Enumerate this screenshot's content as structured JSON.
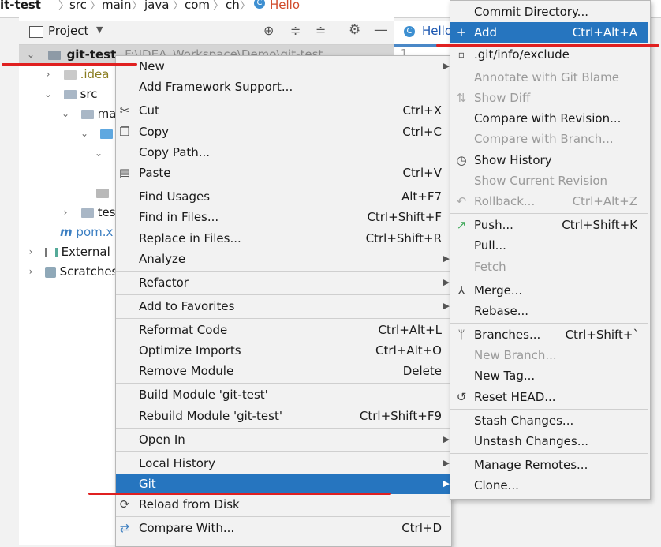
{
  "breadcrumb": {
    "items": [
      "it-test",
      "src",
      "main",
      "java",
      "com",
      "ch",
      "Hello"
    ]
  },
  "project_panel": {
    "title": "Project",
    "tree": {
      "root": "git-test",
      "root_path": "F:\\IDEA_Workspace\\Demo\\git-test",
      "idea": ".idea",
      "src": "src",
      "main": "ma",
      "test": "tes",
      "pom": "pom.x",
      "external": "External L",
      "scratches": "Scratches"
    }
  },
  "editor": {
    "tab": "Hello",
    "line_number": "1"
  },
  "context_menu": {
    "items": [
      {
        "label": "New",
        "submenu": true
      },
      {
        "label": "Add Framework Support..."
      },
      {
        "label": "Cut",
        "shortcut": "Ctrl+X",
        "icon": "scissors-icon"
      },
      {
        "label": "Copy",
        "shortcut": "Ctrl+C",
        "icon": "copy-icon"
      },
      {
        "label": "Copy Path..."
      },
      {
        "label": "Paste",
        "shortcut": "Ctrl+V",
        "icon": "paste-icon"
      },
      {
        "label": "Find Usages",
        "shortcut": "Alt+F7"
      },
      {
        "label": "Find in Files...",
        "shortcut": "Ctrl+Shift+F"
      },
      {
        "label": "Replace in Files...",
        "shortcut": "Ctrl+Shift+R"
      },
      {
        "label": "Analyze",
        "submenu": true
      },
      {
        "label": "Refactor",
        "submenu": true
      },
      {
        "label": "Add to Favorites",
        "submenu": true
      },
      {
        "label": "Reformat Code",
        "shortcut": "Ctrl+Alt+L"
      },
      {
        "label": "Optimize Imports",
        "shortcut": "Ctrl+Alt+O"
      },
      {
        "label": "Remove Module",
        "shortcut": "Delete"
      },
      {
        "label": "Build Module 'git-test'"
      },
      {
        "label": "Rebuild Module 'git-test'",
        "shortcut": "Ctrl+Shift+F9"
      },
      {
        "label": "Open In",
        "submenu": true
      },
      {
        "label": "Local History",
        "submenu": true
      },
      {
        "label": "Git",
        "submenu": true,
        "selected": true
      },
      {
        "label": "Reload from Disk",
        "icon": "reload-icon"
      },
      {
        "label": "Compare With...",
        "shortcut": "Ctrl+D",
        "icon": "compare-icon"
      }
    ]
  },
  "git_menu": {
    "items": [
      {
        "label": "Commit Directory..."
      },
      {
        "label": "Add",
        "shortcut": "Ctrl+Alt+A",
        "icon": "plus-icon",
        "selected": true
      },
      {
        "label": ".git/info/exclude",
        "icon": "file-icon"
      },
      {
        "label": "Annotate with Git Blame",
        "disabled": true
      },
      {
        "label": "Show Diff",
        "disabled": true,
        "icon": "diff-icon"
      },
      {
        "label": "Compare with Revision..."
      },
      {
        "label": "Compare with Branch...",
        "disabled": true
      },
      {
        "label": "Show History",
        "icon": "clock-icon"
      },
      {
        "label": "Show Current Revision",
        "disabled": true
      },
      {
        "label": "Rollback...",
        "shortcut": "Ctrl+Alt+Z",
        "disabled": true,
        "icon": "rollback-icon"
      },
      {
        "label": "Push...",
        "shortcut": "Ctrl+Shift+K",
        "icon": "push-icon"
      },
      {
        "label": "Pull..."
      },
      {
        "label": "Fetch",
        "disabled": true
      },
      {
        "label": "Merge...",
        "icon": "merge-icon"
      },
      {
        "label": "Rebase..."
      },
      {
        "label": "Branches...",
        "shortcut": "Ctrl+Shift+`",
        "icon": "branch-icon"
      },
      {
        "label": "New Branch...",
        "disabled": true
      },
      {
        "label": "New Tag..."
      },
      {
        "label": "Reset HEAD...",
        "icon": "reset-icon"
      },
      {
        "label": "Stash Changes..."
      },
      {
        "label": "Unstash Changes..."
      },
      {
        "label": "Manage Remotes..."
      },
      {
        "label": "Clone..."
      }
    ]
  },
  "colors": {
    "highlight": "#2675bf",
    "annotation_red": "#e02020",
    "disabled_text": "#9a9a9a"
  }
}
